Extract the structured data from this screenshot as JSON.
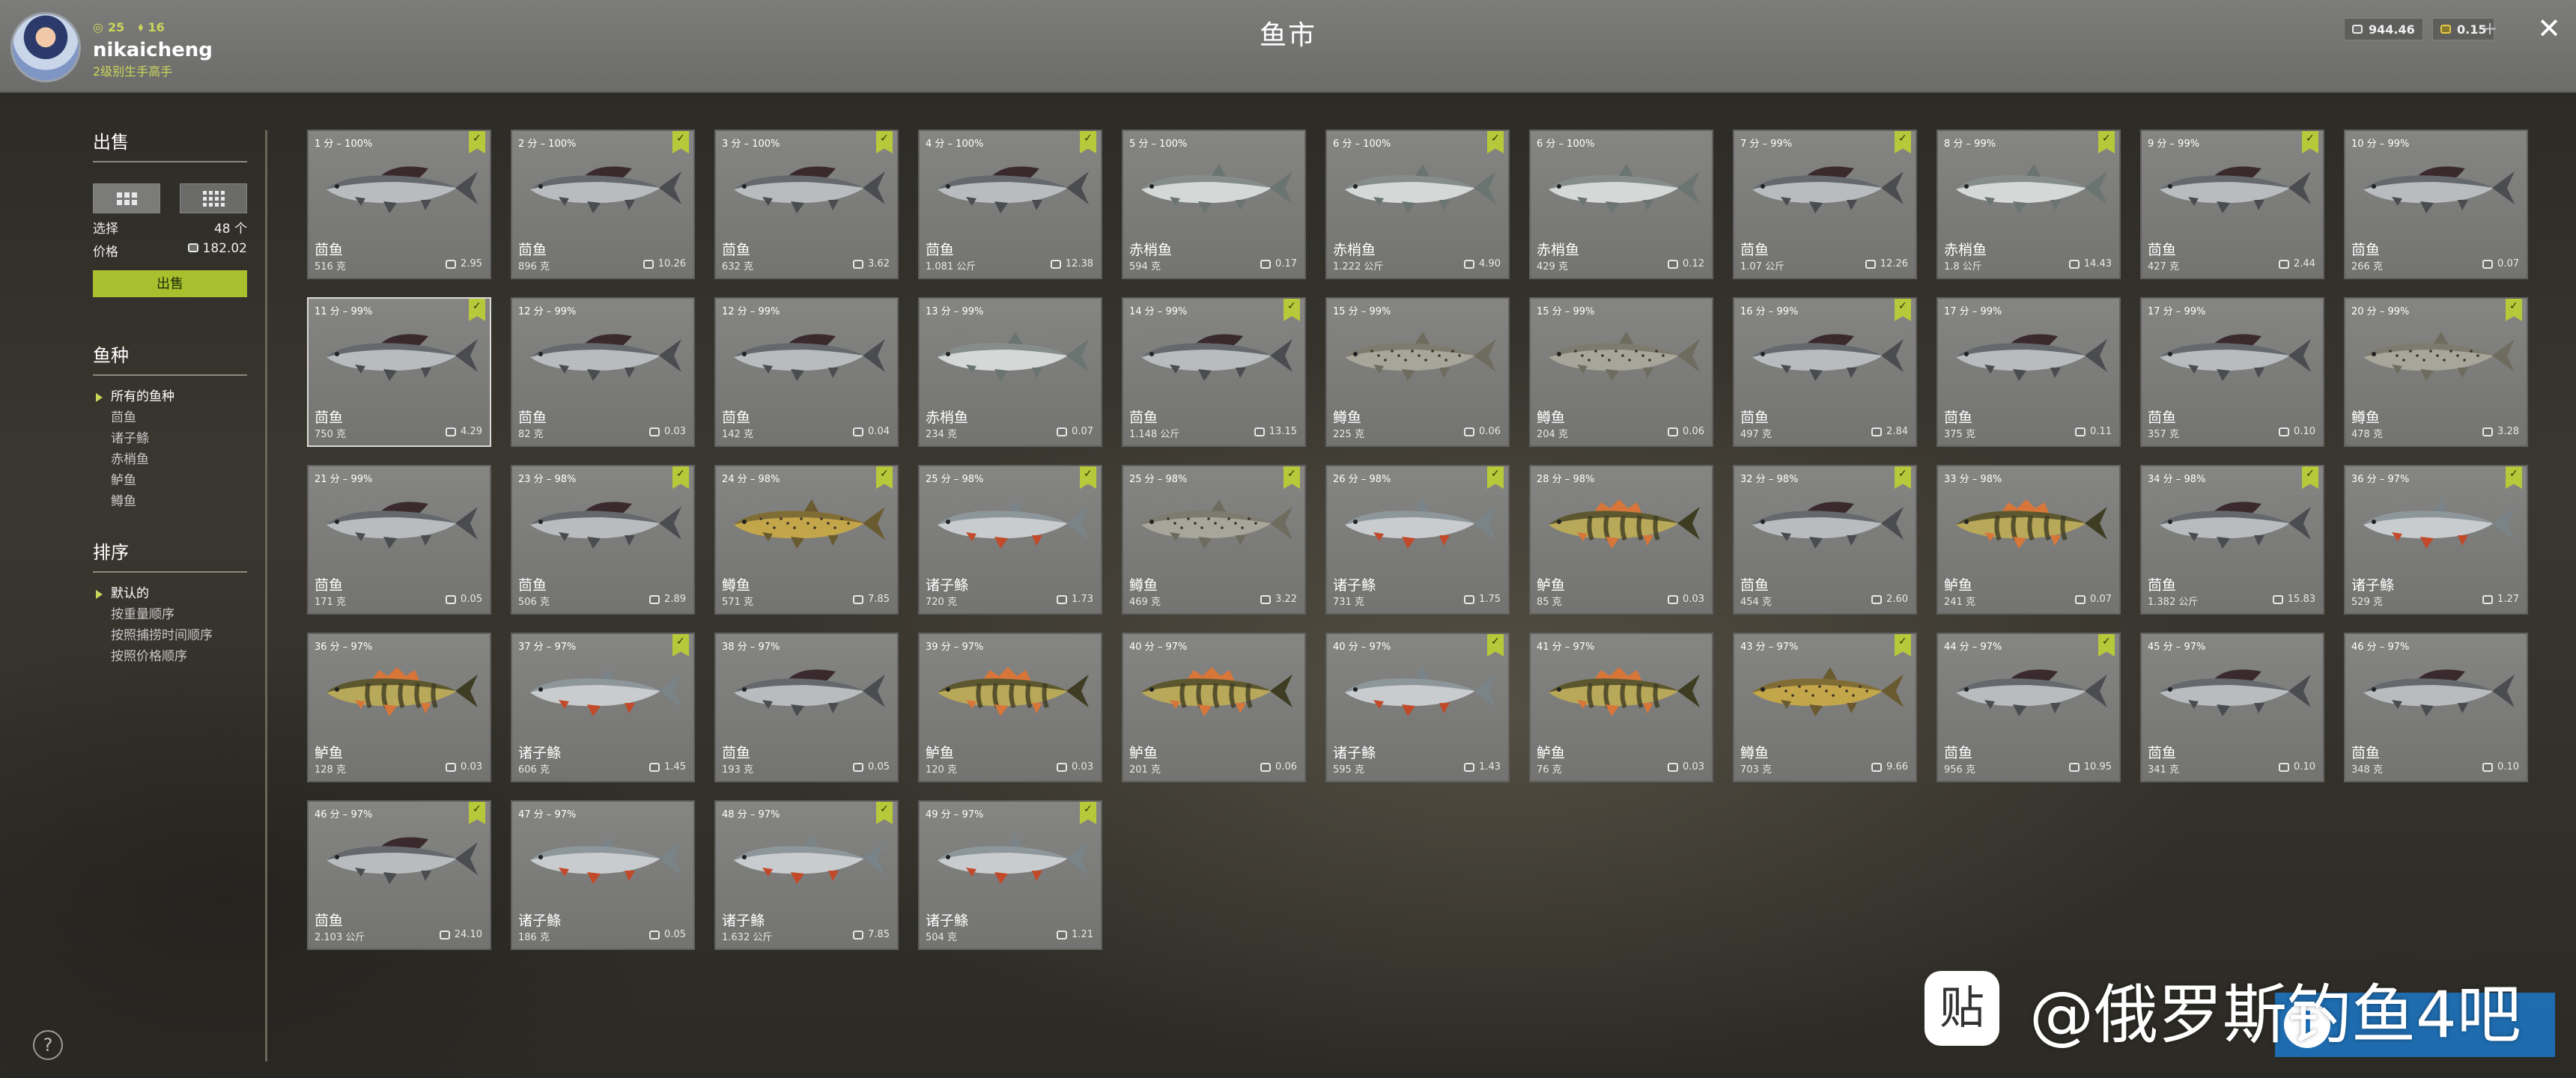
{
  "header": {
    "title": "鱼市",
    "user": {
      "name": "nikaicheng",
      "rank_label": "2级别生手高手",
      "stat_1": "25",
      "stat_2": "16"
    },
    "currency": {
      "silver": "944.46",
      "gold": "0.15",
      "add": "+"
    },
    "close": "✕"
  },
  "sidebar": {
    "sell_title": "出售",
    "select_label": "选择",
    "select_value": "48 个",
    "price_label": "价格",
    "price_value": "182.02",
    "sell_button": "出售",
    "species_title": "鱼种",
    "species": [
      "所有的鱼种",
      "茴鱼",
      "诸子鲦",
      "赤梢鱼",
      "鲈鱼",
      "鳟鱼"
    ],
    "sort_title": "排序",
    "sort": [
      "默认的",
      "按重量顺序",
      "按照捕捞时间顺序",
      "按照价格顺序"
    ],
    "help": "?"
  },
  "fish": [
    {
      "score": "1 分 – 100%",
      "name": "茴鱼",
      "weight": "516 克",
      "price": "2.95",
      "checked": true,
      "kind": "grayling"
    },
    {
      "score": "2 分 – 100%",
      "name": "茴鱼",
      "weight": "896 克",
      "price": "10.26",
      "checked": true,
      "kind": "grayling"
    },
    {
      "score": "3 分 – 100%",
      "name": "茴鱼",
      "weight": "632 克",
      "price": "3.62",
      "checked": true,
      "kind": "grayling"
    },
    {
      "score": "4 分 – 100%",
      "name": "茴鱼",
      "weight": "1.081 公斤",
      "price": "12.38",
      "checked": true,
      "kind": "grayling"
    },
    {
      "score": "5 分 – 100%",
      "name": "赤梢鱼",
      "weight": "594 克",
      "price": "0.17",
      "checked": false,
      "kind": "rudd"
    },
    {
      "score": "6 分 – 100%",
      "name": "赤梢鱼",
      "weight": "1.222 公斤",
      "price": "4.90",
      "checked": true,
      "kind": "rudd"
    },
    {
      "score": "6 分 – 100%",
      "name": "赤梢鱼",
      "weight": "429 克",
      "price": "0.12",
      "checked": false,
      "kind": "rudd"
    },
    {
      "score": "7 分 – 99%",
      "name": "茴鱼",
      "weight": "1.07 公斤",
      "price": "12.26",
      "checked": true,
      "kind": "grayling"
    },
    {
      "score": "8 分 – 99%",
      "name": "赤梢鱼",
      "weight": "1.8 公斤",
      "price": "14.43",
      "checked": true,
      "kind": "rudd"
    },
    {
      "score": "9 分 – 99%",
      "name": "茴鱼",
      "weight": "427 克",
      "price": "2.44",
      "checked": true,
      "kind": "grayling"
    },
    {
      "score": "10 分 – 99%",
      "name": "茴鱼",
      "weight": "266 克",
      "price": "0.07",
      "checked": false,
      "kind": "grayling"
    },
    {
      "score": "11 分 – 99%",
      "name": "茴鱼",
      "weight": "750 克",
      "price": "4.29",
      "checked": true,
      "kind": "grayling",
      "selected": true
    },
    {
      "score": "12 分 – 99%",
      "name": "茴鱼",
      "weight": "82 克",
      "price": "0.03",
      "checked": false,
      "kind": "grayling"
    },
    {
      "score": "12 分 – 99%",
      "name": "茴鱼",
      "weight": "142 克",
      "price": "0.04",
      "checked": false,
      "kind": "grayling"
    },
    {
      "score": "13 分 – 99%",
      "name": "赤梢鱼",
      "weight": "234 克",
      "price": "0.07",
      "checked": false,
      "kind": "rudd"
    },
    {
      "score": "14 分 – 99%",
      "name": "茴鱼",
      "weight": "1.148 公斤",
      "price": "13.15",
      "checked": true,
      "kind": "grayling"
    },
    {
      "score": "15 分 – 99%",
      "name": "鳟鱼",
      "weight": "225 克",
      "price": "0.06",
      "checked": false,
      "kind": "trout"
    },
    {
      "score": "15 分 – 99%",
      "name": "鳟鱼",
      "weight": "204 克",
      "price": "0.06",
      "checked": false,
      "kind": "trout"
    },
    {
      "score": "16 分 – 99%",
      "name": "茴鱼",
      "weight": "497 克",
      "price": "2.84",
      "checked": true,
      "kind": "grayling"
    },
    {
      "score": "17 分 – 99%",
      "name": "茴鱼",
      "weight": "375 克",
      "price": "0.11",
      "checked": false,
      "kind": "grayling"
    },
    {
      "score": "17 分 – 99%",
      "name": "茴鱼",
      "weight": "357 克",
      "price": "0.10",
      "checked": false,
      "kind": "grayling"
    },
    {
      "score": "20 分 – 99%",
      "name": "鳟鱼",
      "weight": "478 克",
      "price": "3.28",
      "checked": true,
      "kind": "trout"
    },
    {
      "score": "21 分 – 99%",
      "name": "茴鱼",
      "weight": "171 克",
      "price": "0.05",
      "checked": false,
      "kind": "grayling"
    },
    {
      "score": "23 分 – 98%",
      "name": "茴鱼",
      "weight": "506 克",
      "price": "2.89",
      "checked": true,
      "kind": "grayling"
    },
    {
      "score": "24 分 – 98%",
      "name": "鳟鱼",
      "weight": "571 克",
      "price": "7.85",
      "checked": true,
      "kind": "brown"
    },
    {
      "score": "25 分 – 98%",
      "name": "诸子鲦",
      "weight": "720 克",
      "price": "1.73",
      "checked": true,
      "kind": "chub"
    },
    {
      "score": "25 分 – 98%",
      "name": "鳟鱼",
      "weight": "469 克",
      "price": "3.22",
      "checked": true,
      "kind": "trout"
    },
    {
      "score": "26 分 – 98%",
      "name": "诸子鲦",
      "weight": "731 克",
      "price": "1.75",
      "checked": true,
      "kind": "chub"
    },
    {
      "score": "28 分 – 98%",
      "name": "鲈鱼",
      "weight": "85 克",
      "price": "0.03",
      "checked": false,
      "kind": "perch"
    },
    {
      "score": "32 分 – 98%",
      "name": "茴鱼",
      "weight": "454 克",
      "price": "2.60",
      "checked": true,
      "kind": "grayling"
    },
    {
      "score": "33 分 – 98%",
      "name": "鲈鱼",
      "weight": "241 克",
      "price": "0.07",
      "checked": false,
      "kind": "perch"
    },
    {
      "score": "34 分 – 98%",
      "name": "茴鱼",
      "weight": "1.382 公斤",
      "price": "15.83",
      "checked": true,
      "kind": "grayling"
    },
    {
      "score": "36 分 – 97%",
      "name": "诸子鲦",
      "weight": "529 克",
      "price": "1.27",
      "checked": true,
      "kind": "chub"
    },
    {
      "score": "36 分 – 97%",
      "name": "鲈鱼",
      "weight": "128 克",
      "price": "0.03",
      "checked": false,
      "kind": "perch"
    },
    {
      "score": "37 分 – 97%",
      "name": "诸子鲦",
      "weight": "606 克",
      "price": "1.45",
      "checked": true,
      "kind": "chub"
    },
    {
      "score": "38 分 – 97%",
      "name": "茴鱼",
      "weight": "193 克",
      "price": "0.05",
      "checked": false,
      "kind": "grayling"
    },
    {
      "score": "39 分 – 97%",
      "name": "鲈鱼",
      "weight": "120 克",
      "price": "0.03",
      "checked": false,
      "kind": "perch"
    },
    {
      "score": "40 分 – 97%",
      "name": "鲈鱼",
      "weight": "201 克",
      "price": "0.06",
      "checked": false,
      "kind": "perch"
    },
    {
      "score": "40 分 – 97%",
      "name": "诸子鲦",
      "weight": "595 克",
      "price": "1.43",
      "checked": true,
      "kind": "chub"
    },
    {
      "score": "41 分 – 97%",
      "name": "鲈鱼",
      "weight": "76 克",
      "price": "0.03",
      "checked": false,
      "kind": "perch"
    },
    {
      "score": "43 分 – 97%",
      "name": "鳟鱼",
      "weight": "703 克",
      "price": "9.66",
      "checked": true,
      "kind": "brown"
    },
    {
      "score": "44 分 – 97%",
      "name": "茴鱼",
      "weight": "956 克",
      "price": "10.95",
      "checked": true,
      "kind": "grayling"
    },
    {
      "score": "45 分 – 97%",
      "name": "茴鱼",
      "weight": "341 克",
      "price": "0.10",
      "checked": false,
      "kind": "grayling"
    },
    {
      "score": "46 分 – 97%",
      "name": "茴鱼",
      "weight": "348 克",
      "price": "0.10",
      "checked": false,
      "kind": "grayling"
    },
    {
      "score": "46 分 – 97%",
      "name": "茴鱼",
      "weight": "2.103 公斤",
      "price": "24.10",
      "checked": true,
      "kind": "grayling"
    },
    {
      "score": "47 分 – 97%",
      "name": "诸子鲦",
      "weight": "186 克",
      "price": "0.05",
      "checked": false,
      "kind": "chub"
    },
    {
      "score": "48 分 – 97%",
      "name": "诸子鲦",
      "weight": "1.632 公斤",
      "price": "7.85",
      "checked": true,
      "kind": "chub"
    },
    {
      "score": "49 分 – 97%",
      "name": "诸子鲦",
      "weight": "504 克",
      "price": "1.21",
      "checked": true,
      "kind": "chub"
    }
  ],
  "fish_colors": {
    "grayling": {
      "body": "#b9bcbf",
      "back": "#4a4c50",
      "fin": "#3a2a2e"
    },
    "rudd": {
      "body": "#d4d8d6",
      "back": "#6a7470",
      "fin": "#9aa4a2"
    },
    "trout": {
      "body": "#a8a69a",
      "back": "#6e6c5e",
      "fin": "#8a8878"
    },
    "brown": {
      "body": "#c4a64a",
      "back": "#6a5a30",
      "fin": "#8a7a44"
    },
    "chub": {
      "body": "#c8ccce",
      "back": "#7a8488",
      "fin": "#c24a2a"
    },
    "perch": {
      "body": "#b8a85a",
      "back": "#3e3c22",
      "fin": "#d8763a"
    }
  },
  "watermark": {
    "text": "@俄罗斯钓鱼4吧",
    "logo": "贴",
    "info": "i"
  }
}
